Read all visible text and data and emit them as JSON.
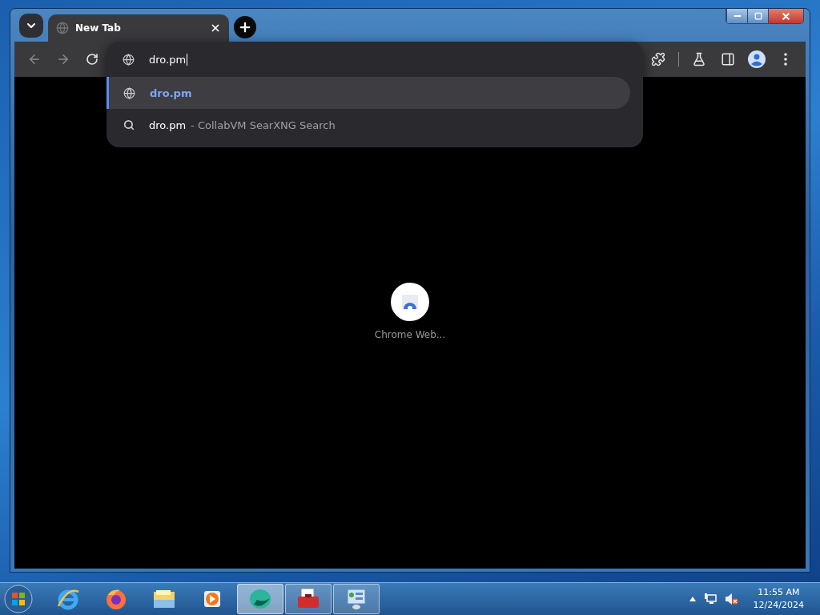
{
  "tabs": [
    {
      "title": "New Tab",
      "selected": true
    }
  ],
  "omnibox": {
    "value": "dro.pm"
  },
  "suggestions": [
    {
      "kind": "url",
      "text": "dro.pm",
      "selected": true
    },
    {
      "kind": "search",
      "text": "dro.pm",
      "description": "- CollabVM SearXNG Search",
      "selected": false
    }
  ],
  "shortcut": {
    "label": "Chrome Web..."
  },
  "taskbar": {
    "apps": [
      {
        "kind": "ie",
        "running": false,
        "selected": false
      },
      {
        "kind": "firefox",
        "running": false,
        "selected": false
      },
      {
        "kind": "explorer",
        "running": false,
        "selected": false
      },
      {
        "kind": "media",
        "running": false,
        "selected": false
      },
      {
        "kind": "browser",
        "running": true,
        "selected": true
      },
      {
        "kind": "toolbox",
        "running": true,
        "selected": false
      },
      {
        "kind": "control",
        "running": true,
        "selected": false
      }
    ],
    "time": "11:55 AM",
    "date": "12/24/2024"
  }
}
